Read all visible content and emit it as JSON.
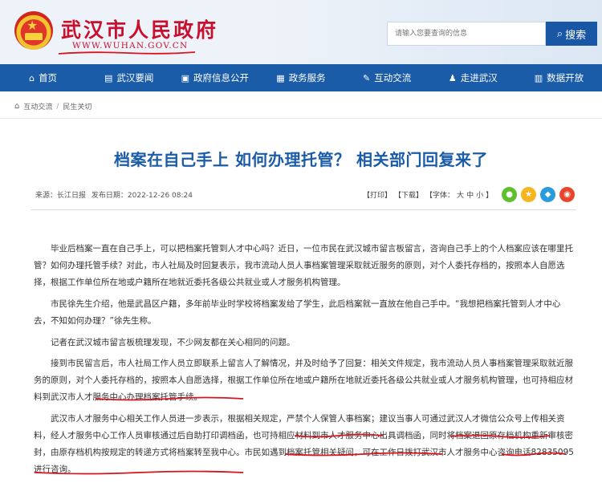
{
  "header": {
    "site_title": "武汉市人民政府",
    "site_url": "WWW.WUHAN.GOV.CN",
    "search_placeholder": "请输入您要查询的信息",
    "search_button": "搜索"
  },
  "nav": [
    {
      "label": "首页",
      "icon": "home-icon",
      "glyph": "⌂"
    },
    {
      "label": "武汉要闻",
      "icon": "news-icon",
      "glyph": "▤"
    },
    {
      "label": "政府信息公开",
      "icon": "info-open-icon",
      "glyph": "▣"
    },
    {
      "label": "政务服务",
      "icon": "service-icon",
      "glyph": "▦"
    },
    {
      "label": "互动交流",
      "icon": "chat-icon",
      "glyph": "✎"
    },
    {
      "label": "走进武汉",
      "icon": "walk-icon",
      "glyph": "♟"
    },
    {
      "label": "数据开放",
      "icon": "data-chart-icon",
      "glyph": "▥"
    }
  ],
  "breadcrumb": {
    "items": [
      "互动交流",
      "民生关切"
    ],
    "separator": "/"
  },
  "article": {
    "title": "档案在自己手上 如何办理托管？ 相关部门回复来了",
    "source": "来源：长江日报",
    "date": "发布日期：2022-12-26 08:24",
    "print": "【打印】",
    "download": "【下载】",
    "font_label": "【字体：",
    "font_large": "大",
    "font_medium": "中",
    "font_small": "小",
    "font_close": "】",
    "share": [
      {
        "icon": "wechat-icon",
        "color": "#5fbf2c"
      },
      {
        "icon": "favorite-star-icon",
        "color": "#f5b51e"
      },
      {
        "icon": "qq-icon",
        "color": "#2a9bdc"
      },
      {
        "icon": "weibo-icon",
        "color": "#e8452c"
      }
    ],
    "paragraphs": [
      "毕业后档案一直在自己手上，可以把档案托管到人才中心吗？近日，一位市民在武汉城市留言板留言，咨询自己手上的个人档案应该在哪里托管？如何办理托管手续？对此，市人社局及时回复表示，我市流动人员人事档案管理采取就近服务的原则，对个人委托存档的，按照本人自愿选择，根据工作单位所在地或户籍所在地就近委托各级公共就业或人才服务机构管理。",
      "市民徐先生介绍，他是武昌区户籍，多年前毕业时学校将档案发给了学生，此后档案就一直放在他自己手中。“我想把档案托管到人才中心去，不知如何办理？”徐先生称。",
      "记者在武汉城市留言板梳理发现，不少网友都在关心相同的问题。",
      "接到市民留言后，市人社局工作人员立即联系上留言人了解情况，并及时给予了回复：相关文件规定，我市流动人员人事档案管理采取就近服务的原则，对个人委托存档的，按照本人自愿选择，根据工作单位所在地或户籍所在地就近委托各级公共就业或人才服务机构管理，也可持相应材料到武汉市人才服务中心办理档案托管手续。",
      "武汉市人才服务中心相关工作人员进一步表示，根据相关规定，严禁个人保管人事档案；建议当事人可通过武汉人才微信公众号上传相关资料，经人才服务中心工作人员审核通过后自助打印调档函，也可持相应材料到市人才服务中心出具调档函，同时将档案退回原存档机构重新审核密封，由原存档机构按规定的转递方式将档案转至我中心。市民如遇到档案托管相关疑问，可在工作日拨打武汉市人才服务中心咨询电话82835095进行咨询。"
    ]
  },
  "colors": {
    "brand_red": "#c8102e",
    "nav_blue": "#1b5ca8",
    "title_blue": "#1b5ca8",
    "annotation_red": "#d9141e"
  }
}
